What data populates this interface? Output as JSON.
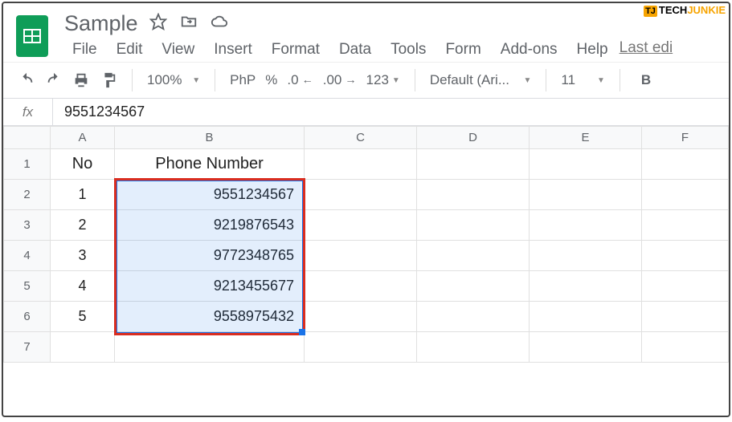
{
  "watermark": {
    "tj": "TJ",
    "tech": "TECH",
    "junkie": "JUNKIE"
  },
  "doc": {
    "title": "Sample",
    "last_edit": "Last edi"
  },
  "menu": {
    "file": "File",
    "edit": "Edit",
    "view": "View",
    "insert": "Insert",
    "format": "Format",
    "data": "Data",
    "tools": "Tools",
    "form": "Form",
    "addons": "Add-ons",
    "help": "Help"
  },
  "toolbar": {
    "zoom": "100%",
    "currency_fmt": "PhP",
    "percent": "%",
    "dec_dec": ".0",
    "inc_dec": ".00",
    "fmt123": "123",
    "font": "Default (Ari...",
    "font_size": "11",
    "bold": "B"
  },
  "formula": {
    "label": "fx",
    "value": "9551234567"
  },
  "columns": [
    "A",
    "B",
    "C",
    "D",
    "E",
    "F"
  ],
  "rows": [
    "1",
    "2",
    "3",
    "4",
    "5",
    "6",
    "7"
  ],
  "data": {
    "headers": {
      "no": "No",
      "phone": "Phone Number"
    },
    "items": [
      {
        "no": "1",
        "phone": "9551234567"
      },
      {
        "no": "2",
        "phone": "9219876543"
      },
      {
        "no": "3",
        "phone": "9772348765"
      },
      {
        "no": "4",
        "phone": "9213455677"
      },
      {
        "no": "5",
        "phone": "9558975432"
      }
    ]
  }
}
